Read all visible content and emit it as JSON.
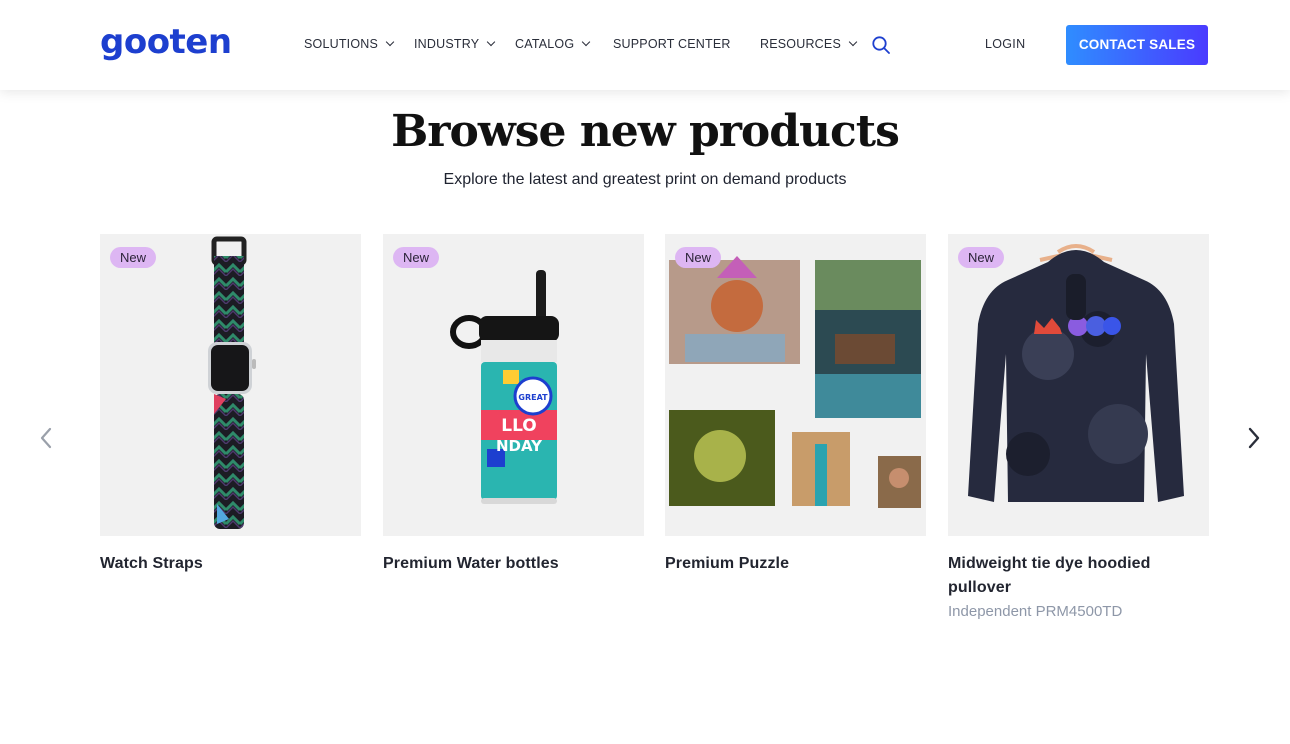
{
  "header": {
    "logo": "gooten",
    "nav": [
      {
        "label": "SOLUTIONS",
        "has_dropdown": true
      },
      {
        "label": "INDUSTRY",
        "has_dropdown": true
      },
      {
        "label": "CATALOG",
        "has_dropdown": true
      },
      {
        "label": "SUPPORT CENTER",
        "has_dropdown": false
      },
      {
        "label": "RESOURCES",
        "has_dropdown": true
      }
    ],
    "search_icon": "search-icon",
    "login": "LOGIN",
    "contact_sales": "CONTACT SALES"
  },
  "main": {
    "title": "Browse new products",
    "subtitle": "Explore the latest and greatest print on demand products",
    "products": [
      {
        "badge": "New",
        "title": "Watch Straps",
        "subtitle": ""
      },
      {
        "badge": "New",
        "title": "Premium Water bottles",
        "subtitle": ""
      },
      {
        "badge": "New",
        "title": "Premium Puzzle",
        "subtitle": ""
      },
      {
        "badge": "New",
        "title": "Midweight tie dye hoodied pullover",
        "subtitle": "Independent PRM4500TD"
      }
    ],
    "prev_icon": "chevron-left-icon",
    "next_icon": "chevron-right-icon"
  },
  "colors": {
    "logo": "#1d3fcf",
    "button_gradient_start": "#2f8dff",
    "button_gradient_end": "#4a3bff",
    "badge": "#ddb6f3",
    "muted_text": "#8e97a8"
  }
}
